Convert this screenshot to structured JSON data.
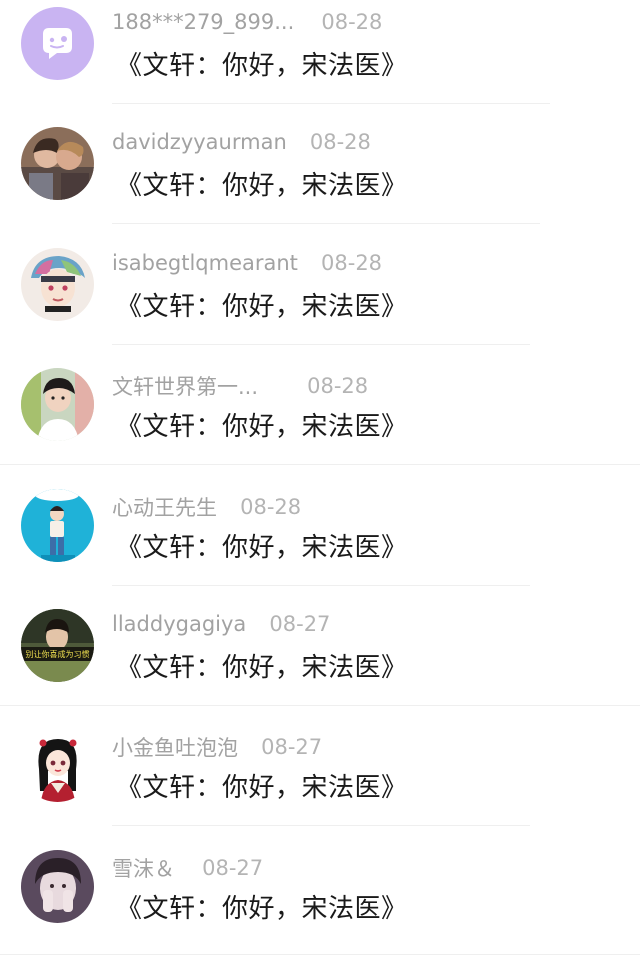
{
  "comments": [
    {
      "name": "188***279_899...",
      "date": "08-28",
      "message": "《文轩：你好，宋法医》",
      "avatar": "default-chat-avatar"
    },
    {
      "name": "davidzyyaurman",
      "date": "08-28",
      "message": "《文轩：你好，宋法医》",
      "avatar": "couple-photo-avatar"
    },
    {
      "name": "isabegtlqmearant",
      "date": "08-28",
      "message": "《文轩：你好，宋法医》",
      "avatar": "anime-boy-avatar"
    },
    {
      "name": "文轩世界第一...",
      "date": "08-28",
      "message": "《文轩：你好，宋法医》",
      "avatar": "young-man-photo-avatar"
    },
    {
      "name": "心动王先生",
      "date": "08-28",
      "message": "《文轩：你好，宋法医》",
      "avatar": "cartoon-blue-sky-avatar"
    },
    {
      "name": "lladdygagiya",
      "date": "08-27",
      "message": "《文轩：你好，宋法医》",
      "avatar": "meme-photo-avatar",
      "avatar_caption": "别让你喜成为习惯"
    },
    {
      "name": "小金鱼吐泡泡",
      "date": "08-27",
      "message": "《文轩：你好，宋法医》",
      "avatar": "anime-girl-avatar"
    },
    {
      "name": "雪沫＆",
      "date": "08-27",
      "message": "《文轩：你好，宋法医》",
      "avatar": "girl-face-photo-avatar"
    }
  ],
  "colors": {
    "name": "#a2a2a2",
    "date": "#b4b4b4",
    "message": "#1a1a1a",
    "divider": "#efefef",
    "default_avatar_bg": "#c9b4f2"
  }
}
